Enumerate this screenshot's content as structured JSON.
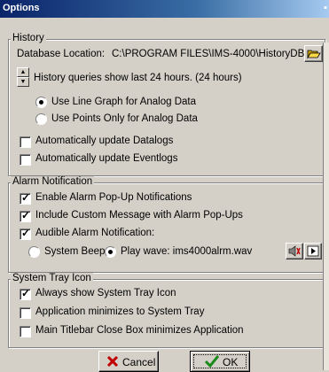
{
  "window": {
    "title": "Options"
  },
  "history": {
    "legend": "History",
    "db_location_label": "Database Location:",
    "db_location_value": "C:\\PROGRAM FILES\\IMS-4000\\HistoryDB\\",
    "queries_text": "History queries show last 24 hours. (24 hours)",
    "radio_line_graph": "Use Line Graph for Analog Data",
    "radio_points": "Use Points Only for Analog Data",
    "chk_datalogs": "Automatically update Datalogs",
    "chk_eventlogs": "Automatically update Eventlogs"
  },
  "alarm": {
    "legend": "Alarm Notification",
    "chk_popup": "Enable Alarm Pop-Up Notifications",
    "chk_custom_msg": "Include Custom Message with Alarm Pop-Ups",
    "chk_audible": "Audible Alarm Notification:",
    "radio_beep": "System Beep",
    "radio_wave": "Play wave: ims4000alrm.wav"
  },
  "tray": {
    "legend": "System Tray Icon",
    "chk_always": "Always show System Tray Icon",
    "chk_minimize": "Application minimizes to System Tray",
    "chk_close": "Main Titlebar Close Box minimizes Application"
  },
  "buttons": {
    "cancel": "Cancel",
    "ok": "OK"
  },
  "state": {
    "line_graph_selected": true,
    "datalogs_checked": false,
    "eventlogs_checked": false,
    "popup_checked": true,
    "custom_msg_checked": true,
    "audible_checked": true,
    "play_wave_selected": true,
    "always_show_checked": true,
    "minimize_checked": false,
    "close_box_checked": false
  },
  "colors": {
    "face": "#d4d0c8",
    "title_bar": "#0a246a",
    "cancel_x": "#c00000",
    "ok_check": "#1a8a1a"
  },
  "icons": {
    "folder": "folder-open-icon",
    "speaker": "speaker-icon",
    "play": "play-icon",
    "cancel": "red-x-icon",
    "ok": "green-check-icon"
  }
}
